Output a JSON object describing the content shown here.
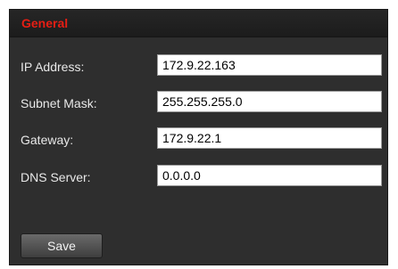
{
  "panel": {
    "title": "General",
    "title_color": "#e61e14",
    "background_color": "#2e2e2e"
  },
  "fields": {
    "ip_address": {
      "label": "IP Address:",
      "value": "172.9.22.163"
    },
    "subnet_mask": {
      "label": "Subnet Mask:",
      "value": "255.255.255.0"
    },
    "gateway": {
      "label": "Gateway:",
      "value": "172.9.22.1"
    },
    "dns_server": {
      "label": "DNS Server:",
      "value": "0.0.0.0"
    }
  },
  "actions": {
    "save_label": "Save"
  }
}
